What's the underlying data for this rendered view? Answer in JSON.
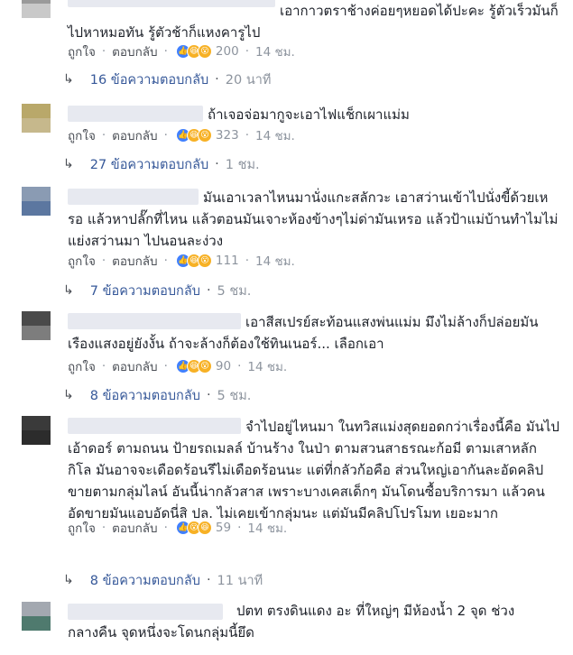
{
  "actions": {
    "like": "ถูกใจ",
    "reply": "ตอบกลับ"
  },
  "comments": [
    {
      "text": "เอากาวตราช้างค่อยๆหยอดได้ปะคะ รู้ตัวเร็วมันก็ไปหาหมอทัน รู้ตัวช้าก็แหงคารูไป",
      "reaction_count": "200",
      "time": "14 ชม.",
      "replies": "16 ข้อความตอบกลับ",
      "reply_time": "20 นาที"
    },
    {
      "text": "ถ้าเจอจ่อมากูจะเอาไฟแช็กเผาแม่ม",
      "reaction_count": "323",
      "time": "14 ชม.",
      "replies": "27 ข้อความตอบกลับ",
      "reply_time": "1 ชม."
    },
    {
      "text": "มันเอาเวลาไหนมานั่งแกะสลักวะ เอาสว่านเข้าไปนั่งขี้ด้วยเหรอ แล้วหาปลั๊กที่ไหน แล้วตอนมันเจาะห้องข้างๆไม่ด่ามันเหรอ แล้วป้าแม่บ้านทำไมไม่แย่งสว่านมา ไปนอนละง่วง",
      "reaction_count": "111",
      "time": "14 ชม.",
      "replies": "7 ข้อความตอบกลับ",
      "reply_time": "5 ชม."
    },
    {
      "text": "เอาสีสเปรย์สะท้อนแสงพ่นแม่ม มึงไม่ล้างก็ปล่อยมันเรืองแสงอยู่ยังงั้น ถ้าจะล้างก็ต้องใช้ทินเนอร์... เลือกเอา",
      "reaction_count": "90",
      "time": "14 ชม.",
      "replies": "8 ข้อความตอบกลับ",
      "reply_time": "5 ชม."
    },
    {
      "text": "จำไปอยู่ไหนมา ในทวิสแม่งสุดยอดกว่าเรื่องนี้คือ มันไปเอ้าดอร์ ตามถนน ป้ายรถเมลล์ บ้านร้าง ในป่า ตามสวนสาธรณะก้อมี ตามเสาหลักกิโล มันอาจจะเดือดร้อนรึไม่เดือดร้อนนะ แต่ที่กลัวก้อคือ ส่วนใหญ่เอากันละอัดคลิปขายตามกลุ่มไลน์ อันนี้น่ากลัวสาส เพราะบางเคสเด็กๆ มันโดนซื้อบริการมา แล้วคนอัดขายมันแอบอัดนี่สิ ปล. ไม่เคยเข้ากลุ่มนะ แต่มันมีคลิปโปรโมท เยอะมาก",
      "reaction_count": "59",
      "time": "14 ชม.",
      "replies": "8 ข้อความตอบกลับ",
      "reply_time": "11 นาที"
    },
    {
      "text": "ปตท ตรงดินแดง อะ ที่ใหญ่ๆ มีห้องน้ำ 2 จุด ช่วงกลางคืน จุดหนึ่งจะโดนกลุ่มนี้ยึด"
    }
  ]
}
